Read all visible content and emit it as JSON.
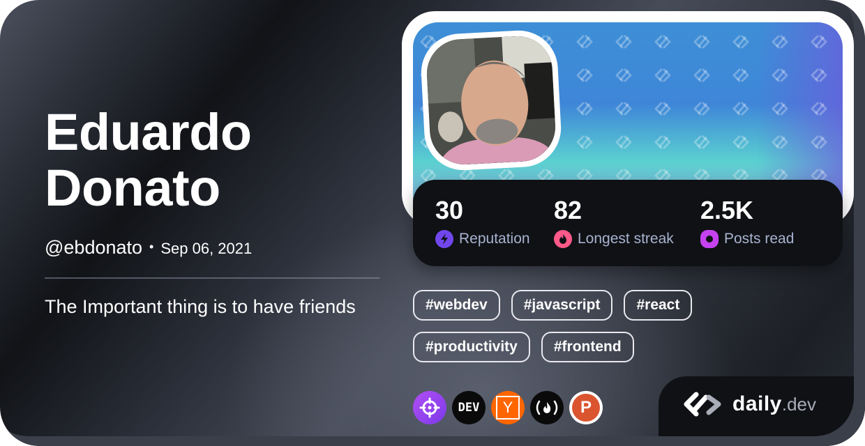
{
  "profile": {
    "first_name": "Eduardo",
    "last_name": "Donato",
    "handle": "@ebdonato",
    "separator": "•",
    "joined": "Sep 06, 2021",
    "bio": "The Important thing is to have friends"
  },
  "stats": [
    {
      "value": "30",
      "label": "Reputation",
      "icon": "lightning-icon",
      "color": "#7147ed"
    },
    {
      "value": "82",
      "label": "Longest streak",
      "icon": "flame-icon",
      "color": "#ff5a8a"
    },
    {
      "value": "2.5K",
      "label": "Posts read",
      "icon": "eye-icon",
      "color": "#c642f0"
    }
  ],
  "tags": [
    "#webdev",
    "#javascript",
    "#react",
    "#productivity",
    "#frontend"
  ],
  "sources": [
    {
      "name": "crosshair-source",
      "icon": "crosshair-icon",
      "bg": "#9a3ff0"
    },
    {
      "name": "dev-to",
      "text": "DEV",
      "bg": "#0a0a0a"
    },
    {
      "name": "hacker-news",
      "text": "Y",
      "bg": "#ff6600"
    },
    {
      "name": "freecodecamp",
      "text": "(🔥)",
      "bg": "#0a0a0a"
    },
    {
      "name": "product-hunt",
      "text": "P",
      "bg": "#da552f"
    }
  ],
  "brand": {
    "name": "daily",
    "suffix": ".dev"
  },
  "colors": {
    "accent_purple": "#7147ed",
    "accent_pink": "#ff5a8a",
    "accent_magenta": "#c642f0",
    "stats_bg": "#0f1115",
    "label_color": "#a8b3cf"
  }
}
